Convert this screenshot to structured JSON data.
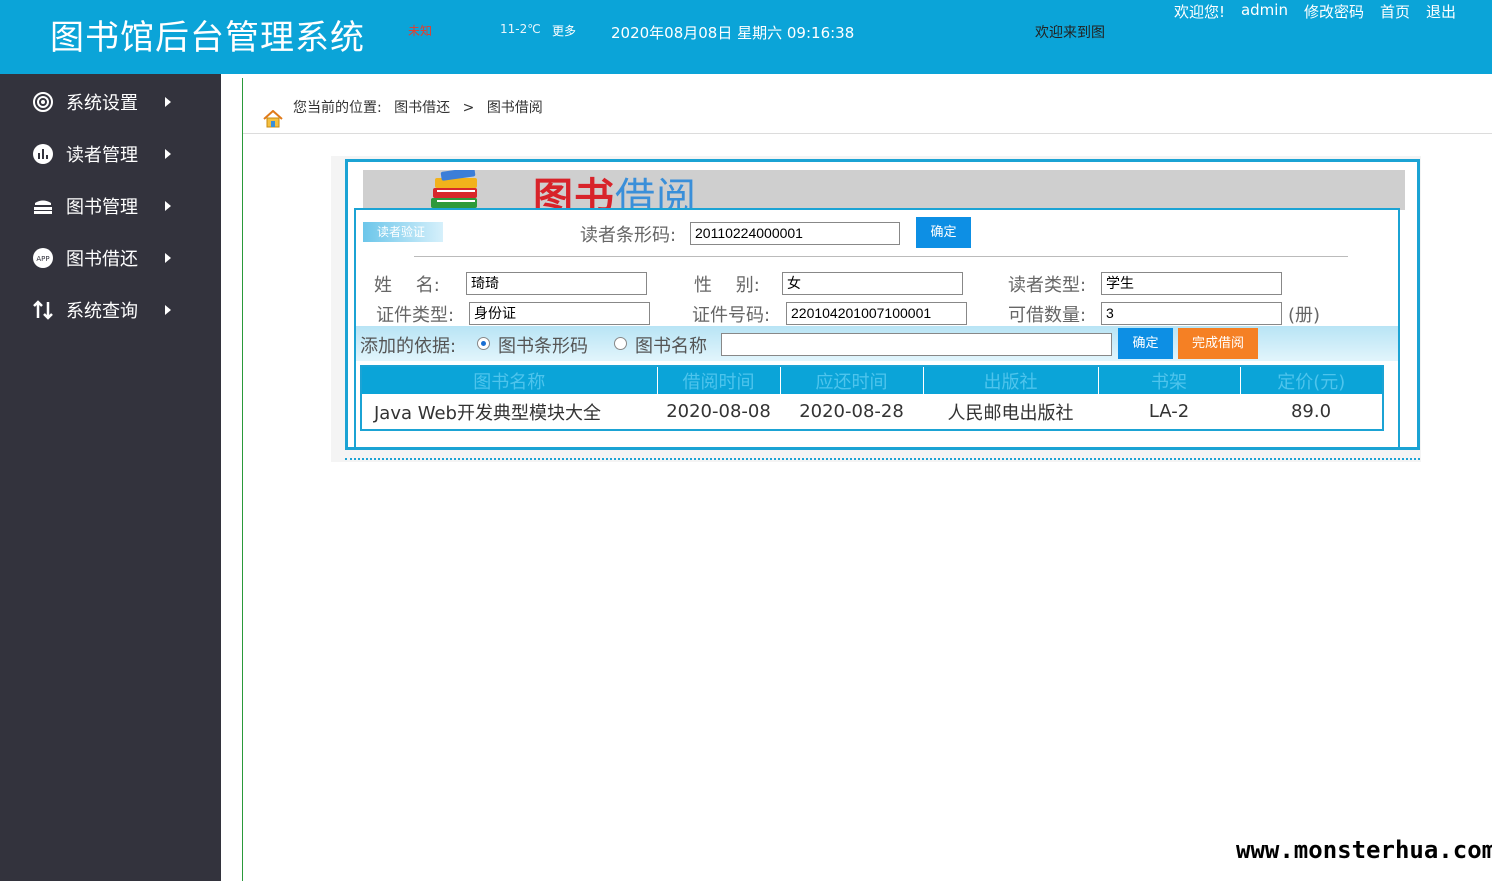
{
  "header": {
    "title": "图书馆后台管理系统",
    "weather_city": "未知",
    "weather_temp": "11-2℃",
    "weather_more": "更多",
    "datetime": "2020年08月08日 星期六 09:16:38",
    "welcome_marquee": "欢迎来到图",
    "welcome": "欢迎您!",
    "user": "admin",
    "links": {
      "change_password": "修改密码",
      "home": "首页",
      "logout": "退出"
    }
  },
  "sidebar": {
    "items": [
      {
        "label": "系统设置",
        "icon": "gear-icon"
      },
      {
        "label": "读者管理",
        "icon": "chart-icon"
      },
      {
        "label": "图书管理",
        "icon": "books-stack-icon"
      },
      {
        "label": "图书借还",
        "icon": "app-icon"
      },
      {
        "label": "系统查询",
        "icon": "swap-icon"
      }
    ]
  },
  "breadcrumb": {
    "prefix": "您当前的位置:",
    "level1": "图书借还",
    "sep": ">",
    "level2": "图书借阅"
  },
  "banner": {
    "title_red": "图书",
    "title_blue": "借阅"
  },
  "reader": {
    "tag": "读者验证",
    "barcode_label": "读者条形码:",
    "barcode_value": "20110224000001",
    "confirm": "确定",
    "name_label": "姓　 名:",
    "name_value": "琦琦",
    "gender_label": "性　 别:",
    "gender_value": "女",
    "type_label": "读者类型:",
    "type_value": "学生",
    "id_type_label": "证件类型:",
    "id_type_value": "身份证",
    "id_no_label": "证件号码:",
    "id_no_value": "220104201007100001",
    "quota_label": "可借数量:",
    "quota_value": "3",
    "quota_unit": "(册)"
  },
  "add_bar": {
    "label": "添加的依据:",
    "option_barcode": "图书条形码",
    "option_name": "图书名称",
    "input_value": "",
    "confirm": "确定",
    "finish": "完成借阅"
  },
  "table": {
    "headers": [
      "图书名称",
      "借阅时间",
      "应还时间",
      "出版社",
      "书架",
      "定价(元)"
    ],
    "rows": [
      [
        "Java Web开发典型模块大全",
        "2020-08-08",
        "2020-08-28",
        "人民邮电出版社",
        "LA-2",
        "89.0"
      ]
    ]
  },
  "watermark": "www.monsterhua.com"
}
